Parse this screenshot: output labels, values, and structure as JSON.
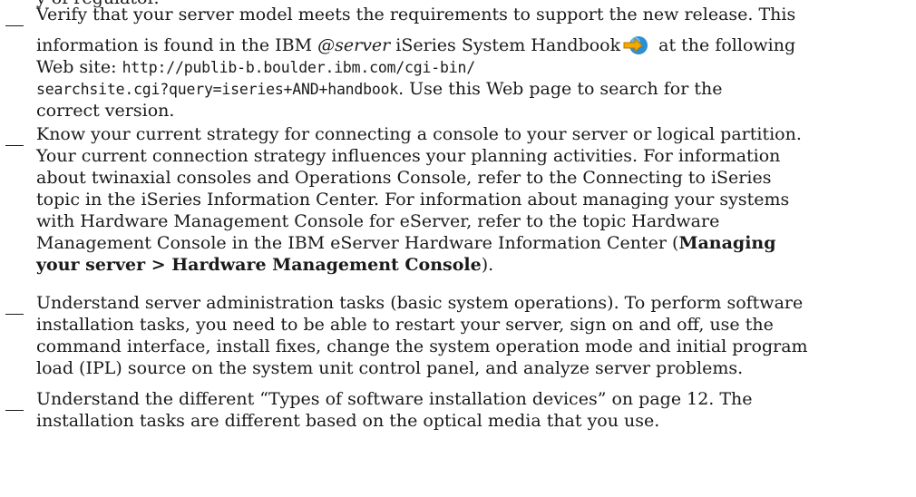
{
  "top_fragment": "y of regulator.",
  "items": [
    {
      "text_a": "Verify that your server model meets the requirements to support the new release. This",
      "text_b1": "information is found in the IBM ",
      "eserver_mark": "@server",
      "text_b2": " iSeries System Handbook",
      "icon": "external-link-icon",
      "text_b3": " at the following",
      "text_c": "Web site: ",
      "url_1": "http://publib-b.boulder.ibm.com/cgi-bin/",
      "url_2": "searchsite.cgi?query=iseries+AND+handbook",
      "text_d": ". Use this Web page to search for the",
      "text_e": "correct version."
    },
    {
      "lines": [
        "Know your current strategy for connecting a console to your server or logical partition.",
        "Your current connection strategy influences your planning activities. For information",
        "about twinaxial consoles and Operations Console, refer to the Connecting to iSeries",
        "topic in the iSeries Information Center. For information about managing your systems",
        "with Hardware Management Console for eServer, refer to the topic Hardware",
        "Management Console in the IBM eServer Hardware Information Center ("
      ],
      "bold_1": "Managing",
      "bold_2": "your server > Hardware Management Console",
      "tail": ")."
    },
    {
      "lines": [
        "Understand server administration tasks (basic system operations). To perform software",
        "installation tasks, you need to be able to restart your server, sign on and off, use the",
        "command interface, install fixes, change the system operation mode and initial program",
        "load (IPL) source on the system unit control panel, and analyze server problems."
      ]
    },
    {
      "lines": [
        "Understand the different “Types of software installation devices” on page 12. The",
        "installation tasks are different based on the optical media that you use."
      ]
    }
  ]
}
